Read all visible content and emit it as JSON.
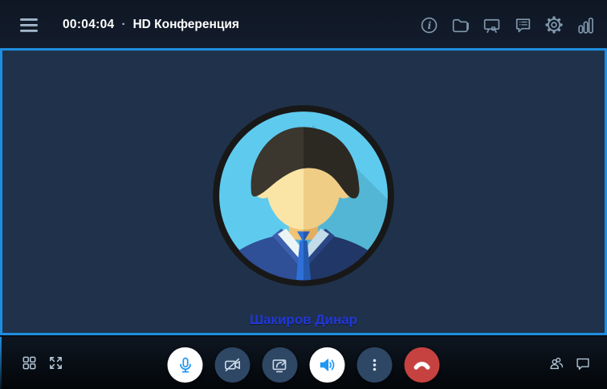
{
  "header": {
    "timer": "00:04:04",
    "separator": "·",
    "title": "HD Конференция",
    "icons": [
      "info",
      "folder",
      "whiteboard",
      "chat-messages",
      "settings",
      "connection-stats"
    ]
  },
  "stage": {
    "participant_name": "Шакиров Динар",
    "avatar": "male-flat-avatar"
  },
  "footer": {
    "left_icons": [
      "grid-layout",
      "fullscreen"
    ],
    "buttons": [
      {
        "name": "microphone",
        "state": "on"
      },
      {
        "name": "camera",
        "state": "off"
      },
      {
        "name": "screen-share",
        "state": "idle"
      },
      {
        "name": "speaker",
        "state": "on"
      },
      {
        "name": "more-options",
        "state": "idle"
      },
      {
        "name": "hang-up",
        "state": "idle"
      }
    ],
    "right_icons": [
      "participants",
      "chat"
    ]
  },
  "colors": {
    "accent_blue": "#1e8fe0",
    "glyph_blue": "#2196f3",
    "name_text": "#2137d9",
    "hangup_red": "#c64240",
    "button_dark": "#2e4765",
    "topbar_bg": "#121a29",
    "video_bg": "#20324b",
    "footer_bg": "#0a0f18",
    "icon_steel": "#8098ad"
  }
}
